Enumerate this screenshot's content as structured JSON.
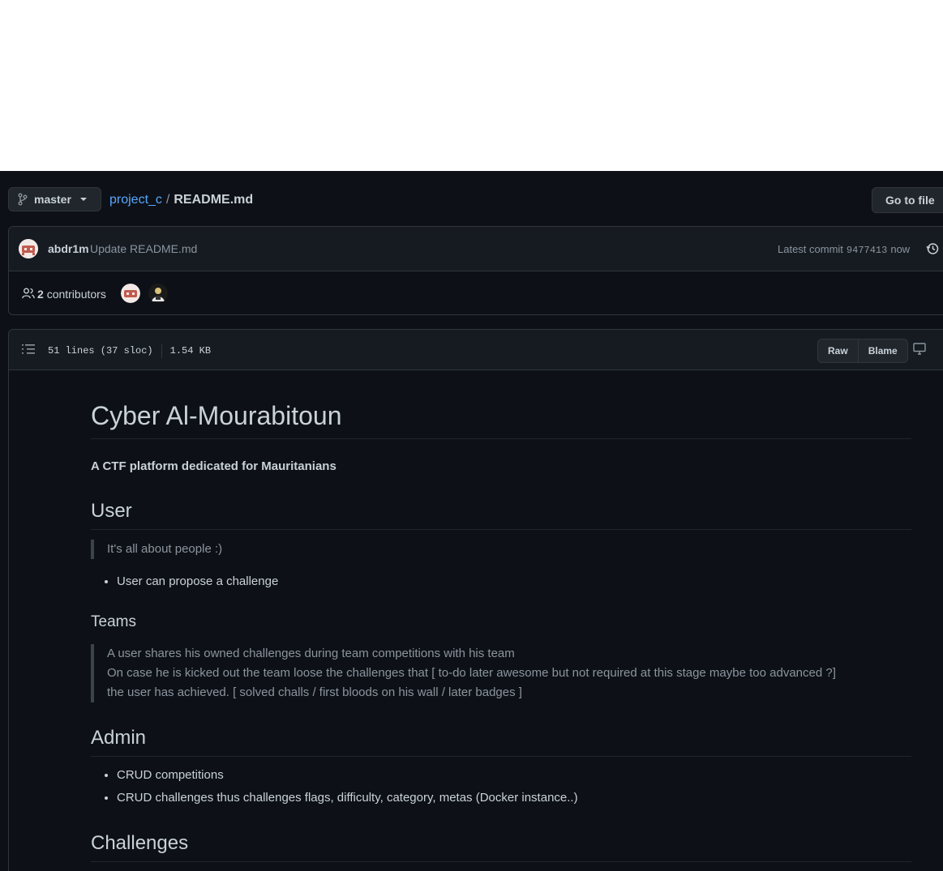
{
  "branch": {
    "label": "master"
  },
  "breadcrumb": {
    "repo": "project_c",
    "separator": "/",
    "file": "README.md"
  },
  "go_to_file": "Go to file",
  "commit": {
    "author": "abdr1m",
    "message": "Update README.md",
    "latest_label": "Latest commit",
    "sha": "9477413",
    "time": "now"
  },
  "contributors": {
    "count": "2",
    "label": "contributors"
  },
  "file": {
    "lines": "51 lines (37 sloc)",
    "size": "1.54 KB",
    "raw": "Raw",
    "blame": "Blame"
  },
  "readme": {
    "title": "Cyber Al-Mourabitoun",
    "subtitle": "A CTF platform dedicated for Mauritanians",
    "user_heading": "User",
    "user_quote": "It's all about people :)",
    "user_items": [
      "User can propose a challenge"
    ],
    "teams_heading": "Teams",
    "teams_quote": [
      "A user shares his owned challenges during team competitions with his team",
      "On case he is kicked out the team loose the challenges that [ to-do later awesome but not required at this stage maybe too advanced ?]",
      "the user has achieved. [ solved challs / first bloods on his wall / later badges ]"
    ],
    "admin_heading": "Admin",
    "admin_items": [
      "CRUD competitions",
      "CRUD challenges thus challenges flags, difficulty, category, metas (Docker instance..)"
    ],
    "challenges_heading": "Challenges"
  }
}
